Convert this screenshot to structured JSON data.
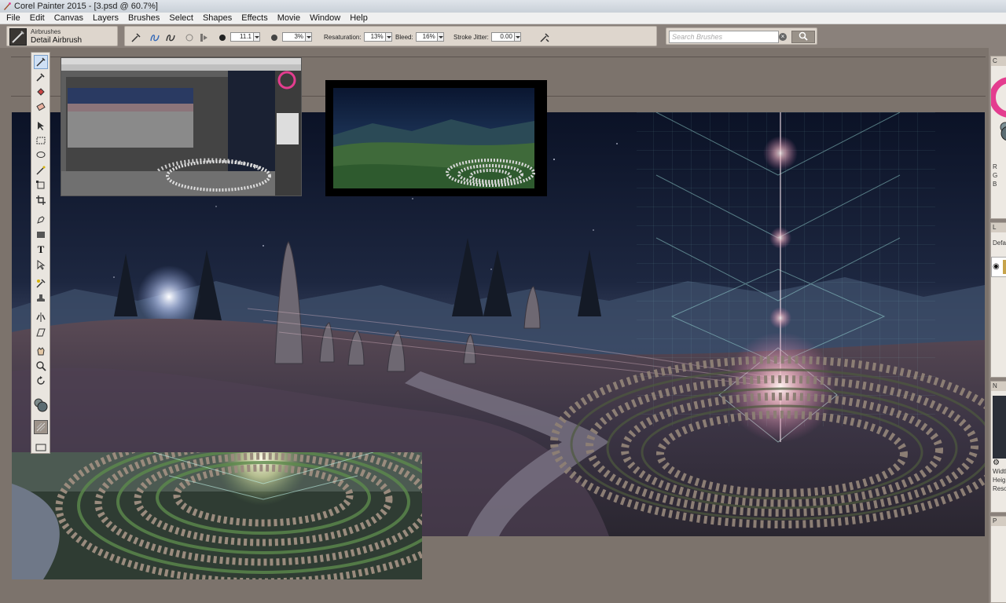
{
  "window": {
    "title": "Corel Painter 2015 - [3.psd @ 60.7%]"
  },
  "menu": [
    "File",
    "Edit",
    "Canvas",
    "Layers",
    "Brushes",
    "Select",
    "Shapes",
    "Effects",
    "Movie",
    "Window",
    "Help"
  ],
  "brush": {
    "category": "Airbrushes",
    "variant": "Detail Airbrush"
  },
  "property_bar": {
    "size_value": "11.1",
    "opacity_value": "3%",
    "resaturation_label": "Resaturation:",
    "resaturation_value": "13%",
    "bleed_label": "Bleed:",
    "bleed_value": "16%",
    "stroke_jitter_label": "Stroke Jitter:",
    "stroke_jitter_value": "0.00"
  },
  "search": {
    "placeholder": "Search Brushes"
  },
  "panels": {
    "color_header": "C",
    "color_labels": [
      "R",
      "G",
      "B"
    ],
    "layers_header": "L",
    "layers_item": "Defa",
    "navigator_header": "N",
    "nav_info": [
      "Width",
      "Heigh",
      "Reso"
    ],
    "paper_header": "P"
  },
  "icons": {
    "tools": [
      "brush-tool-icon",
      "dropper-icon",
      "paint-bucket-icon",
      "eraser-icon",
      "layer-adjuster-icon",
      "rect-select-icon",
      "lasso-icon",
      "magic-wand-icon",
      "transform-icon",
      "crop-icon",
      "pen-icon",
      "rectangle-shape-icon",
      "text-icon",
      "shape-select-icon",
      "cloner-icon",
      "rubber-stamp-icon",
      "mirror-icon",
      "perspective-icon",
      "grabber-icon",
      "magnifier-icon",
      "rotate-page-icon",
      "color-swatch-icon",
      "paper-icon",
      "media-icon"
    ]
  },
  "colors": {
    "accent_main": "#e43d8f",
    "workspace": "#7c736c",
    "propbar": "#ded6cd"
  }
}
